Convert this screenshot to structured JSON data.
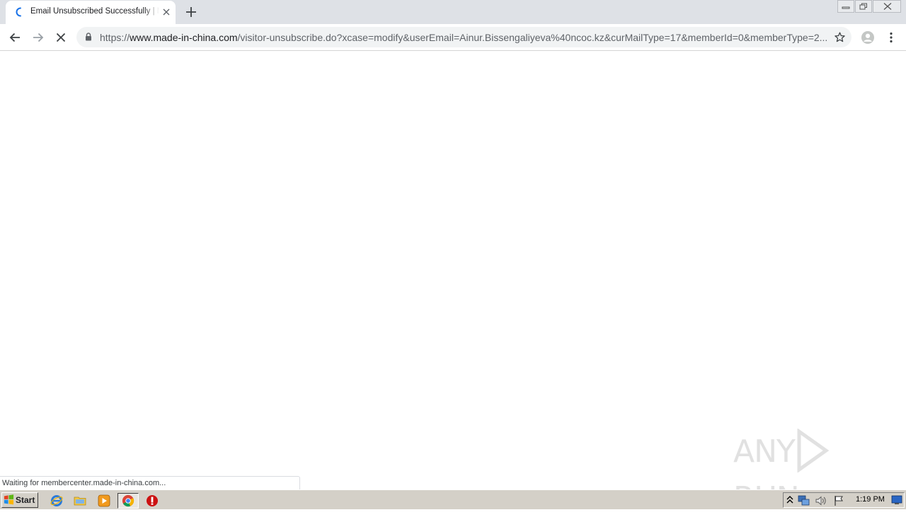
{
  "browser": {
    "tab": {
      "title": "Email Unsubscribed Successfully | Made-in-China.com",
      "loading": true
    },
    "address_bar": {
      "url_scheme": "https://",
      "url_host": "www.made-in-china.com",
      "url_path": "/visitor-unsubscribe.do?xcase=modify&userEmail=Ainur.Bissengaliyeva%40ncoc.kz&curMailType=17&memberId=0&memberType=2..."
    },
    "status_bubble": "Waiting for membercenter.made-in-china.com..."
  },
  "watermark": {
    "left": "ANY",
    "right": "RUN"
  },
  "taskbar": {
    "start_label": "Start",
    "clock": "1:19 PM",
    "quick_launch": [
      "internet-explorer-icon",
      "folder-icon",
      "media-player-icon",
      "chrome-icon",
      "stop-icon"
    ]
  },
  "colors": {
    "tabstrip": "#dee1e6",
    "omnibox": "#f1f3f4",
    "taskbar": "#d4d0c8",
    "chrome_blue": "#1a73e8"
  }
}
